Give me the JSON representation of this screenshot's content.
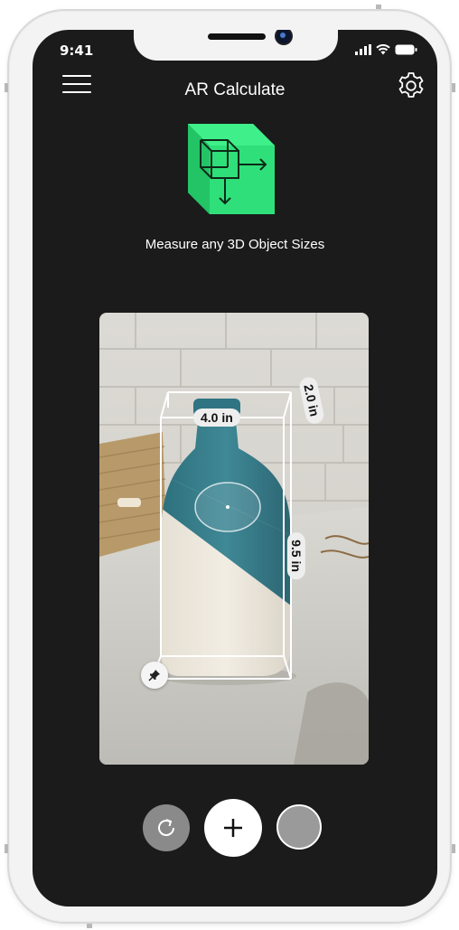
{
  "status_bar": {
    "time": "9:41"
  },
  "header": {
    "title": "AR Calculate",
    "menu_icon": "hamburger-menu-icon",
    "settings_icon": "gear-icon"
  },
  "hero": {
    "logo_icon": "3d-cube-measure-icon",
    "tagline": "Measure any 3D Object Sizes"
  },
  "measurement": {
    "width_label": "4.0 in",
    "depth_label": "2.0 in",
    "height_label": "9.5 in"
  },
  "controls": {
    "refresh_icon": "refresh-icon",
    "add_icon": "plus-icon",
    "capture_icon": "capture-circle-icon"
  },
  "colors": {
    "screen_background": "#1b1b1b",
    "logo_green": "#2fe07a",
    "frame": "#f3f3f3"
  }
}
